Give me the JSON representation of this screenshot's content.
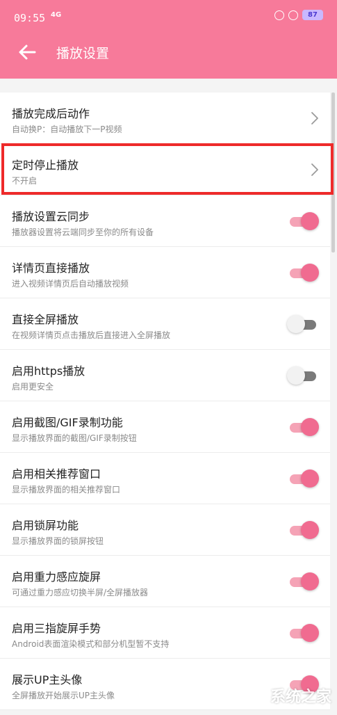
{
  "status": {
    "time": "09:55",
    "network": "4G",
    "battery": "87"
  },
  "header": {
    "title": "播放设置"
  },
  "colors": {
    "accent": "#f77a9a",
    "highlight": "#ee2a2a"
  },
  "settings": [
    {
      "title": "播放完成后动作",
      "subtitle": "自动换P：自动播放下一P视频",
      "type": "nav"
    },
    {
      "title": "定时停止播放",
      "subtitle": "不开启",
      "type": "nav",
      "highlighted": true
    },
    {
      "title": "播放设置云同步",
      "subtitle": "播放器设置将云端同步至你的所有设备",
      "type": "toggle",
      "on": true
    },
    {
      "title": "详情页直接播放",
      "subtitle": "进入视频详情页后自动播放视频",
      "type": "toggle",
      "on": true
    },
    {
      "title": "直接全屏播放",
      "subtitle": "在视频详情页点击播放后直接进入全屏播放",
      "type": "toggle",
      "on": false
    },
    {
      "title": "启用https播放",
      "subtitle": "启用更安全",
      "type": "toggle",
      "on": false
    },
    {
      "title": "启用截图/GIF录制功能",
      "subtitle": "显示播放界面的截图/GIF录制按钮",
      "type": "toggle",
      "on": true
    },
    {
      "title": "启用相关推荐窗口",
      "subtitle": "显示播放界面的相关推荐窗口",
      "type": "toggle",
      "on": true
    },
    {
      "title": "启用锁屏功能",
      "subtitle": "显示播放界面的锁屏按钮",
      "type": "toggle",
      "on": true
    },
    {
      "title": "启用重力感应旋屏",
      "subtitle": "可通过重力感应切换半屏/全屏播放器",
      "type": "toggle",
      "on": true
    },
    {
      "title": "启用三指旋屏手势",
      "subtitle": "Android表面渲染模式和部分机型暂不支持",
      "type": "toggle",
      "on": true
    },
    {
      "title": "展示UP主头像",
      "subtitle": "全屏播放开始展示UP主头像",
      "type": "toggle",
      "on": true
    }
  ],
  "watermark": "系统之家"
}
